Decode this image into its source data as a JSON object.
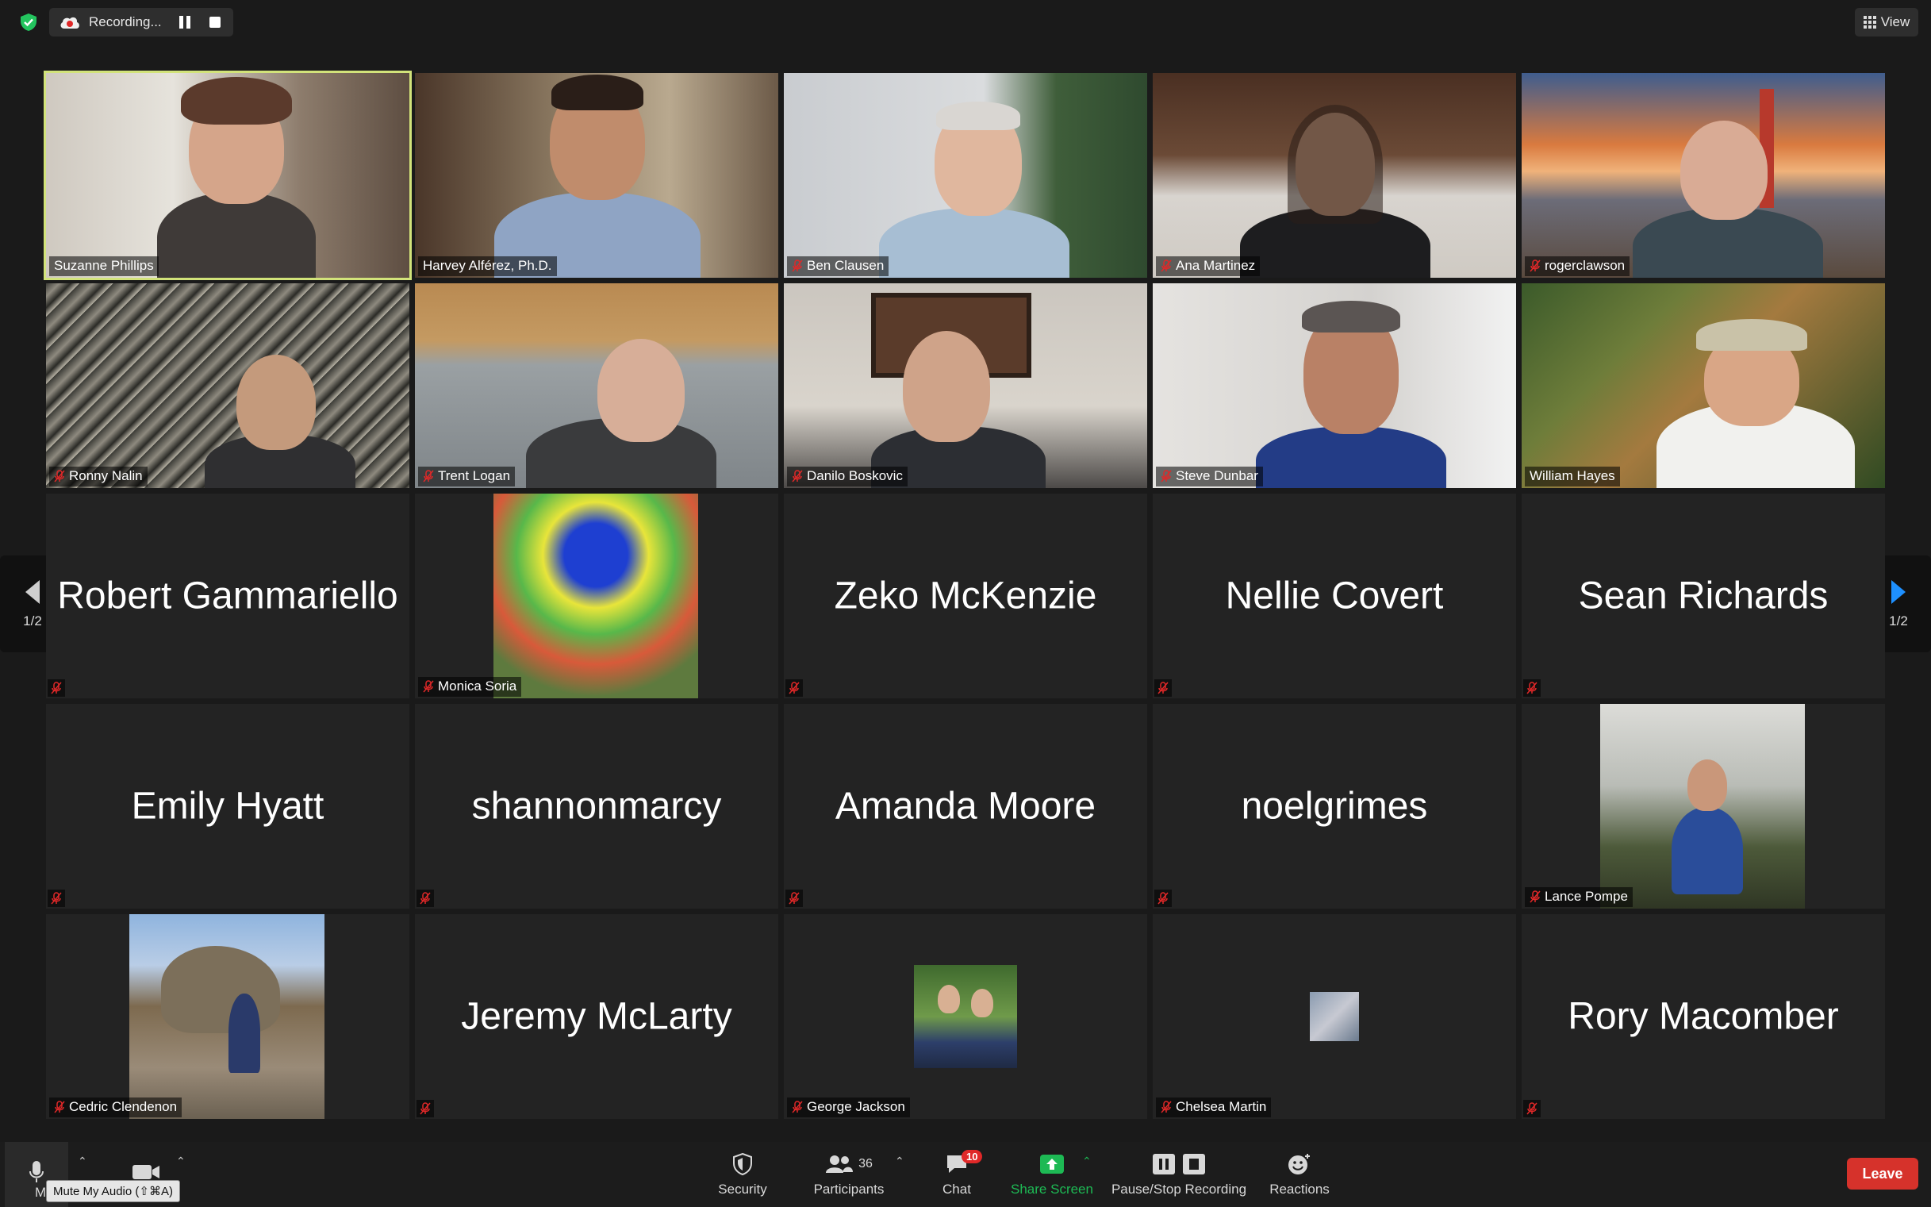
{
  "recording": {
    "label": "Recording..."
  },
  "view_button": {
    "label": "View"
  },
  "pager": {
    "left_label": "1/2",
    "right_label": "1/2"
  },
  "tiles": [
    {
      "name": "Suzanne Phillips",
      "kind": "video",
      "muted": false
    },
    {
      "name": "Harvey Alférez, Ph.D.",
      "kind": "video",
      "muted": false
    },
    {
      "name": "Ben Clausen",
      "kind": "video",
      "muted": true
    },
    {
      "name": "Ana Martinez",
      "kind": "video",
      "muted": true
    },
    {
      "name": "rogerclawson",
      "kind": "video",
      "muted": true
    },
    {
      "name": "Ronny Nalin",
      "kind": "video",
      "muted": true
    },
    {
      "name": "Trent Logan",
      "kind": "video",
      "muted": true
    },
    {
      "name": "Danilo Boskovic",
      "kind": "video",
      "muted": true
    },
    {
      "name": "Steve Dunbar",
      "kind": "video",
      "muted": true
    },
    {
      "name": "William Hayes",
      "kind": "video",
      "muted": false
    },
    {
      "name": "Robert Gammariello",
      "kind": "name",
      "muted": true
    },
    {
      "name": "Monica Soria",
      "kind": "picture",
      "muted": true
    },
    {
      "name": "Zeko McKenzie",
      "kind": "name",
      "muted": true
    },
    {
      "name": "Nellie Covert",
      "kind": "name",
      "muted": true
    },
    {
      "name": "Sean Richards",
      "kind": "name",
      "muted": true
    },
    {
      "name": "Emily Hyatt",
      "kind": "name",
      "muted": true
    },
    {
      "name": "shannonmarcy",
      "kind": "name",
      "muted": true
    },
    {
      "name": "Amanda Moore",
      "kind": "name",
      "muted": true
    },
    {
      "name": "noelgrimes",
      "kind": "name",
      "muted": true
    },
    {
      "name": "Lance Pompe",
      "kind": "picture",
      "muted": true
    },
    {
      "name": "Cedric Clendenon",
      "kind": "picture",
      "muted": true
    },
    {
      "name": "Jeremy McLarty",
      "kind": "name",
      "muted": true
    },
    {
      "name": "George Jackson",
      "kind": "picture",
      "muted": true
    },
    {
      "name": "Chelsea Martin",
      "kind": "picture",
      "muted": true
    },
    {
      "name": "Rory Macomber",
      "kind": "name",
      "muted": true
    }
  ],
  "toolbar": {
    "mute_partial": "M",
    "tooltip": "Mute My Audio (⇧⌘A)",
    "security": "Security",
    "participants": "Participants",
    "participants_count": "36",
    "chat": "Chat",
    "chat_badge": "10",
    "share_screen": "Share Screen",
    "pause_stop_recording": "Pause/Stop Recording",
    "reactions": "Reactions",
    "leave": "Leave"
  },
  "colors": {
    "active_speaker_border": "#d2e37a",
    "share_green": "#1db954",
    "leave_red": "#d6322b",
    "mute_red": "#e02828"
  }
}
